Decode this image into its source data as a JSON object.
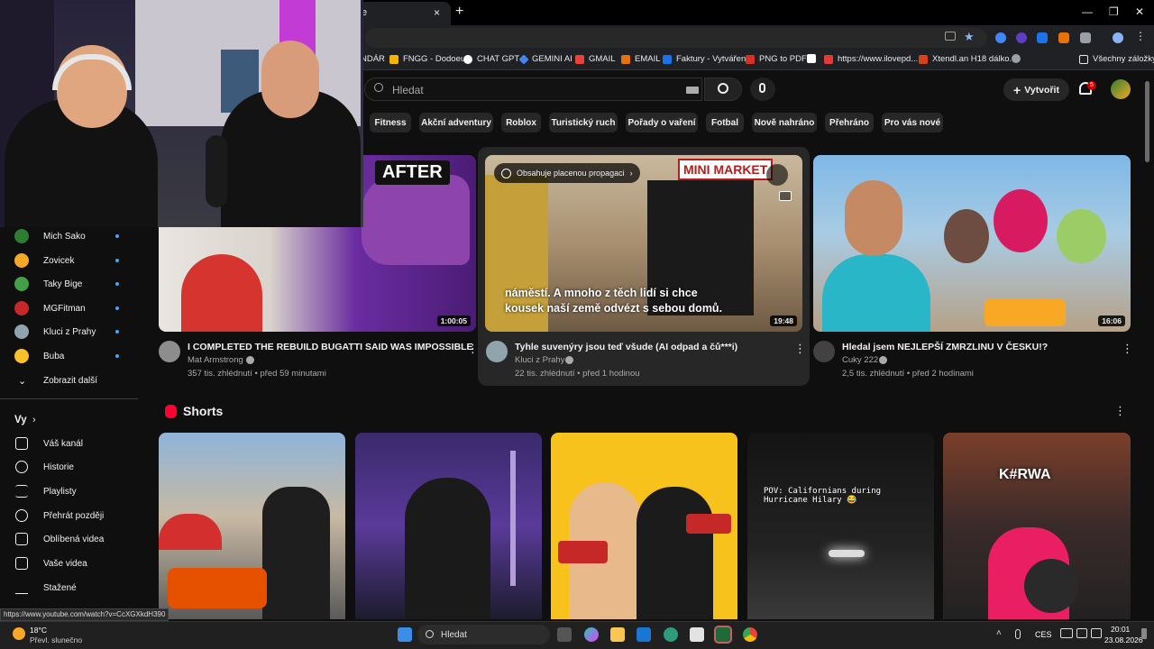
{
  "browser": {
    "tab_title": "e",
    "tab_close": "×",
    "new_tab": "+",
    "window_controls": [
      "—",
      "❐",
      "✕"
    ],
    "bookmarks": [
      {
        "label": "NDÁR",
        "icon": "calendar-icon",
        "color": ""
      },
      {
        "label": "FNGG - Dodoeu",
        "icon": "fngg-icon",
        "color": "#f4b400"
      },
      {
        "label": "CHAT GPT",
        "icon": "chatgpt-icon",
        "color": "#ffffff"
      },
      {
        "label": "GEMINI AI",
        "icon": "gemini-icon",
        "color": "#4285f4"
      },
      {
        "label": "GMAIL",
        "icon": "gmail-icon",
        "color": "#ea4335"
      },
      {
        "label": "EMAIL",
        "icon": "email-icon",
        "color": "#e8710a"
      },
      {
        "label": "Faktury - Vytváření",
        "icon": "invoice-icon",
        "color": "#1a73e8"
      },
      {
        "label": "PNG to PDF",
        "icon": "pdf-icon",
        "color": "#d93025"
      },
      {
        "label": "",
        "icon": "s-icon",
        "color": "#ffffff"
      },
      {
        "label": "https://www.ilovepd...",
        "icon": "ilovepdf-icon",
        "color": "#e53935"
      },
      {
        "label": "Xtendl.an H18 dálko...",
        "icon": "xtend-icon",
        "color": "#d84315"
      },
      {
        "label": "",
        "icon": "globe-icon",
        "color": "#9aa0a6"
      }
    ],
    "all_bookmarks": "Všechny záložky",
    "status_url": "https://www.youtube.com/watch?v=CcXGXkdH390"
  },
  "youtube": {
    "search_placeholder": "Hledat",
    "create_label": "Vytvořit",
    "notification_count": "5",
    "chips": [
      "Fitness",
      "Akční adventury",
      "Roblox",
      "Turistický ruch",
      "Pořady o vaření",
      "Fotbal",
      "Nově nahráno",
      "Přehráno",
      "Pro vás nové"
    ],
    "videos": [
      {
        "title": "I COMPLETED THE REBUILD BUGATTI SAID WAS IMPOSSIBLE",
        "channel": "Mat Armstrong",
        "meta": "357 tis. zhlédnutí • před 59 minutami",
        "duration": "1:00:05",
        "thumb_text": "AFTER"
      },
      {
        "title": "Tyhle suvenýry jsou teď všude (AI odpad a čů***i)",
        "channel": "Kluci z Prahy",
        "meta": "22 tis. zhlédnutí • před 1 hodinou",
        "duration": "19:48",
        "promo": "Obsahuje placenou propagaci",
        "caption": "náměstí. A mnoho z těch lidí si chce kousek naší země odvézt s sebou domů.",
        "thumb_text": "MINI MARKET"
      },
      {
        "title": "Hledal jsem NEJLEPŠÍ ZMRZLINU V ČESKU!?",
        "channel": "Cuky 222",
        "meta": "2,5 tis. zhlédnutí • před 2 hodinami",
        "duration": "16:06"
      }
    ],
    "shorts_title": "Shorts",
    "shorts": [
      {
        "overlay": ""
      },
      {
        "overlay": ""
      },
      {
        "overlay": ""
      },
      {
        "overlay": "POV: Californians during Hurricane Hilary 😂"
      },
      {
        "overlay": "K#RWA"
      }
    ]
  },
  "sidebar": {
    "subscriptions": [
      {
        "label": "Mich Sako",
        "color": "#2e7d32"
      },
      {
        "label": "Zovicek",
        "color": "#f9a825"
      },
      {
        "label": "Taky Bige",
        "color": "#43a047"
      },
      {
        "label": "MGFitman",
        "color": "#c62828"
      },
      {
        "label": "Kluci z Prahy",
        "color": "#90a4ae"
      },
      {
        "label": "Buba",
        "color": "#fbc02d"
      }
    ],
    "show_more": "Zobrazit další",
    "you_header": "Vy",
    "you_items": [
      {
        "label": "Váš kanál",
        "icon": "channel-icon"
      },
      {
        "label": "Historie",
        "icon": "history-icon"
      },
      {
        "label": "Playlisty",
        "icon": "playlist-icon"
      },
      {
        "label": "Přehrát později",
        "icon": "watch-later-icon"
      },
      {
        "label": "Oblíbená videa",
        "icon": "like-icon"
      },
      {
        "label": "Vaše videa",
        "icon": "your-videos-icon"
      },
      {
        "label": "Stažené",
        "icon": "download-icon"
      }
    ]
  },
  "taskbar": {
    "temp": "18°C",
    "weather": "Převl. slunečno",
    "search": "Hledat",
    "lang": "CES",
    "time": "20:01",
    "date": "23.08.2026"
  }
}
